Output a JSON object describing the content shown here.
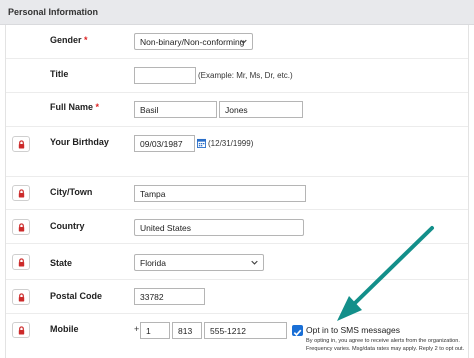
{
  "section": {
    "title": "Personal Information"
  },
  "fields": {
    "gender": {
      "label": "Gender",
      "required": "*",
      "value": "Non-binary/Non-conforming"
    },
    "title": {
      "label": "Title",
      "value": "",
      "hint": "(Example: Mr, Ms, Dr, etc.)"
    },
    "full_name": {
      "label": "Full Name",
      "required": "*",
      "first": "Basil",
      "last": "Jones"
    },
    "birthday": {
      "label": "Your Birthday",
      "value": "09/03/1987",
      "hint": "(12/31/1999)"
    },
    "city": {
      "label": "City/Town",
      "value": "Tampa"
    },
    "country": {
      "label": "Country",
      "value": "United States"
    },
    "state": {
      "label": "State",
      "value": "Florida"
    },
    "postal": {
      "label": "Postal Code",
      "value": "33782"
    },
    "mobile": {
      "label": "Mobile",
      "plus": "+",
      "country_code": "1",
      "area_code": "813",
      "number": "555-1212",
      "sms_label": "Opt in to SMS messages",
      "sms_checked": true,
      "disclaimer_line1": "By opting in, you agree to receive alerts from the organization.",
      "disclaimer_line2": "Frequency varies. Msg/data rates may apply. Reply 2 to opt out."
    }
  },
  "icons": {
    "lock": "lock-icon",
    "calendar": "calendar-icon",
    "chevron": "chevron-down-icon",
    "arrow": "arrow-annotation"
  },
  "colors": {
    "lock_red": "#cc2a2a",
    "arrow_teal": "#138f8a",
    "checkbox_blue": "#1a6fd6",
    "header_bg": "#e8e9ec"
  }
}
